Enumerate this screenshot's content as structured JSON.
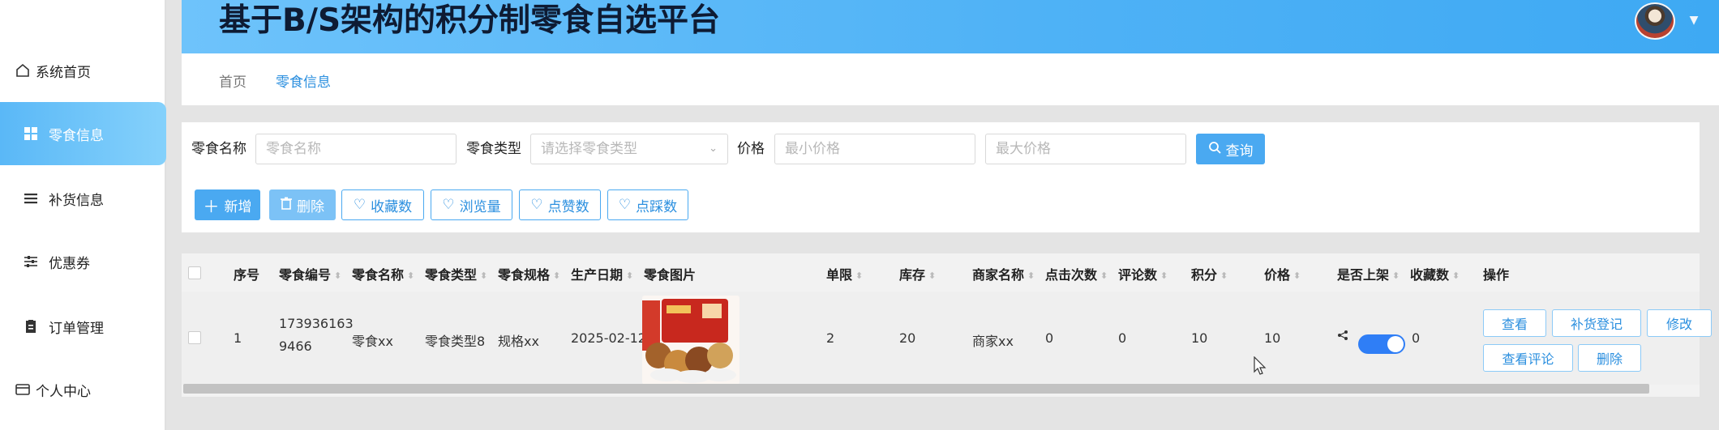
{
  "app": {
    "title": "基于B/S架构的积分制零食自选平台"
  },
  "sidebar": {
    "items": [
      {
        "label": "系统首页",
        "icon": "home-icon"
      },
      {
        "label": "零食信息",
        "icon": "grid-icon",
        "active": true
      },
      {
        "label": "补货信息",
        "icon": "list-icon"
      },
      {
        "label": "优惠券",
        "icon": "sliders-icon"
      },
      {
        "label": "订单管理",
        "icon": "clipboard-icon"
      },
      {
        "label": "个人中心",
        "icon": "card-icon"
      }
    ]
  },
  "breadcrumb": {
    "home": "首页",
    "current": "零食信息"
  },
  "search": {
    "name_label": "零食名称",
    "name_placeholder": "零食名称",
    "type_label": "零食类型",
    "type_placeholder": "请选择零食类型",
    "price_label": "价格",
    "min_price_placeholder": "最小价格",
    "max_price_placeholder": "最大价格",
    "query_button": "查询"
  },
  "toolbar": {
    "add": "新增",
    "delete": "删除",
    "favorites": "收藏数",
    "views": "浏览量",
    "likes": "点赞数",
    "dislikes": "点踩数"
  },
  "table": {
    "headers": {
      "index": "序号",
      "code": "零食编号",
      "name": "零食名称",
      "type": "零食类型",
      "spec": "零食规格",
      "date": "生产日期",
      "image": "零食图片",
      "limit": "单限",
      "stock": "库存",
      "merchant": "商家名称",
      "clicks": "点击次数",
      "comments": "评论数",
      "points": "积分",
      "price": "价格",
      "listed": "是否上架",
      "fav": "收藏数",
      "ops": "操作"
    },
    "row": {
      "index": "1",
      "code_line1": "173936163",
      "code_line2": "9466",
      "name": "零食xx",
      "type": "零食类型8",
      "spec": "规格xx",
      "date": "2025-02-12",
      "limit": "2",
      "stock": "20",
      "merchant": "商家xx",
      "clicks": "0",
      "comments": "0",
      "points": "10",
      "price": "10",
      "listed": true,
      "fav": "0"
    },
    "actions": {
      "view": "查看",
      "restock": "补货登记",
      "edit": "修改",
      "view_comments": "查看评论",
      "delete": "删除"
    }
  },
  "colors": {
    "accent": "#4aa9f1",
    "toggle_on": "#2f7ef6"
  }
}
